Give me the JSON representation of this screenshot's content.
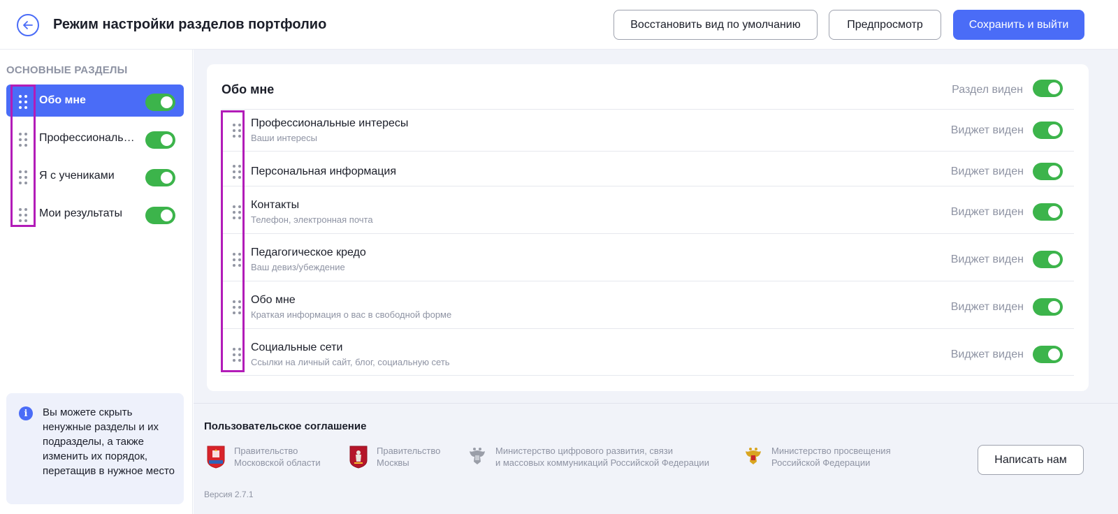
{
  "header": {
    "title": "Режим настройки разделов портфолио",
    "restore_label": "Восстановить вид по умолчанию",
    "preview_label": "Предпросмотр",
    "save_label": "Сохранить и выйти"
  },
  "sidebar": {
    "title": "ОСНОВНЫЕ РАЗДЕЛЫ",
    "items": [
      {
        "label": "Обо мне",
        "active": true,
        "enabled": true
      },
      {
        "label": "Профессиональный рост",
        "active": false,
        "enabled": true
      },
      {
        "label": "Я с учениками",
        "active": false,
        "enabled": true
      },
      {
        "label": "Мои результаты",
        "active": false,
        "enabled": true
      }
    ],
    "info": "Вы можете скрыть ненужные разделы и их подразделы, а также изменить их порядок, перетащив в нужное место"
  },
  "section": {
    "title": "Обо мне",
    "visible_label": "Раздел виден",
    "visible": true,
    "widgets": [
      {
        "title": "Профессиональные интересы",
        "subtitle": "Ваши интересы",
        "visible_label": "Виджет виден",
        "visible": true
      },
      {
        "title": "Персональная информация",
        "subtitle": "",
        "visible_label": "Виджет виден",
        "visible": true
      },
      {
        "title": "Контакты",
        "subtitle": "Телефон, электронная почта",
        "visible_label": "Виджет виден",
        "visible": true
      },
      {
        "title": "Педагогическое кредо",
        "subtitle": "Ваш девиз/убеждение",
        "visible_label": "Виджет виден",
        "visible": true
      },
      {
        "title": "Обо мне",
        "subtitle": "Краткая информация о вас в свободной форме",
        "visible_label": "Виджет виден",
        "visible": true
      },
      {
        "title": "Социальные сети",
        "subtitle": "Ссылки на личный сайт, блог, социальную сеть",
        "visible_label": "Виджет виден",
        "visible": true
      }
    ]
  },
  "footer": {
    "agreement": "Пользовательское соглашение",
    "orgs": [
      {
        "line1": "Правительство",
        "line2": "Московской области"
      },
      {
        "line1": "Правительство",
        "line2": "Москвы"
      },
      {
        "line1": "Министерство цифрового развития, связи",
        "line2": "и массовых коммуникаций Российской Федерации"
      },
      {
        "line1": "Министерство просвещения",
        "line2": "Российской Федерации"
      }
    ],
    "write_label": "Написать нам",
    "version": "Версия 2.7.1"
  },
  "colors": {
    "accent": "#4a6cf7",
    "toggle_on": "#3cb44b",
    "highlight": "#b21cb8"
  }
}
